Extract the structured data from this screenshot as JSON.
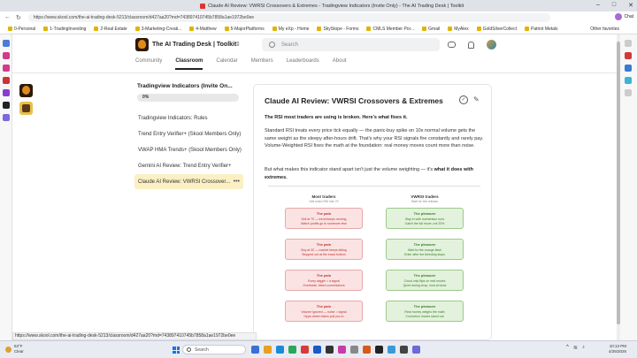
{
  "browser": {
    "tab_title": "Claude AI Review: VWRSI Crossovers & Extremes - Tradingview Indicators (Invite Only) - The AI Trading Desk | Toolkit",
    "url": "https://www.skool.com/the-ai-trading-desk-5213/classroom/d427aa20?md=743897410745b7858a1ae1972be0ee",
    "profile_name": "Chat",
    "bookmarks": [
      "0-Personal",
      "1-TradingInvesting",
      "2-Real Estate",
      "3-Marketing-Creati...",
      "4-Matthew",
      "5-MajorPlatforms",
      "My eXp - Home",
      "SkyStope - Forms",
      "CMLS Member Por...",
      "Gmail",
      "MyAlex",
      "GoldSilverCollect",
      "Patriot Metals"
    ],
    "other_favorites": "Other favorites",
    "status_url": "https://www.skool.com/the-ai-trading-desk-5213/classroom/d427aa20?md=743897410745b7858a1ae1972be0ee"
  },
  "header": {
    "group_title": "The AI Trading Desk | Toolkit",
    "search_placeholder": "Search",
    "nav": [
      "Community",
      "Classroom",
      "Calendar",
      "Members",
      "Leaderboards",
      "About"
    ],
    "active_nav": "Classroom"
  },
  "sidebar": {
    "course_title": "Tradingview Indicators (Invite On...",
    "progress": "0%",
    "lessons": [
      "Tradingview Indicators: Rules",
      "Trend Entry Verifier+ (Skool Members Only)",
      "VWAP HMA Trends+ (Skool Members Only)",
      "Gemini AI Review: Trend Entry Verifier+",
      "Claude AI Review: VWRSI Crossover..."
    ],
    "selected_lesson": 4
  },
  "article": {
    "title": "Claude AI Review: VWRSI Crossovers & Extremes",
    "lead": "The RSI most traders are using is broken. Here's what fixes it.",
    "body": "Standard RSI treats every price tick equally — the panic-buy spike on 10x normal volume gets the same weight as the sleepy after-hours drift. That's why your RSI signals fire constantly and rarely pay. Volume-Weighted RSI fixes the math at the foundation: real money moves count more than noise.",
    "body2_a": "But what makes this indicator stand apart isn't just the volume weighting — it's ",
    "body2_b": "what it does with extremes.",
    "left_col_title": "Most traders",
    "left_col_sub": "Sell when RSI hits 70",
    "right_col_title": "VWRSI traders",
    "right_col_sub": "Wait for the release",
    "pains": [
      {
        "title": "The pain",
        "l1": "Sell at 70 — trend keeps running",
        "l2": "Watch profits go to someone else"
      },
      {
        "title": "The pain",
        "l1": "Buy at 30 — market keeps falling",
        "l2": "Stopped out at the exact bottom"
      },
      {
        "title": "The pain",
        "l1": "Every wiggle = a signal",
        "l2": "Overtrade, bleed commissions"
      },
      {
        "title": "The pain",
        "l1": "Volume ignored — noise = signal",
        "l2": "Hype-driven fakes pull you in"
      }
    ],
    "pleasures": [
      {
        "title": "The pleasure",
        "l1": "Stay in with momentum runs",
        "l2": "Catch the full move, not 20%"
      },
      {
        "title": "The pleasure",
        "l1": "Wait for the orange flash",
        "l2": "Enter after the bleeding stops"
      },
      {
        "title": "The pleasure",
        "l1": "Cloud only flips on real moves",
        "l2": "Quiet during chop, loud at turns"
      },
      {
        "title": "The pleasure",
        "l1": "Real money weighs the math",
        "l2": "Conviction moves stand out"
      }
    ]
  },
  "taskbar": {
    "temp": "63°F",
    "condition": "Clear",
    "search": "Search",
    "time": "10:13 PM",
    "date": "4/26/2026"
  }
}
